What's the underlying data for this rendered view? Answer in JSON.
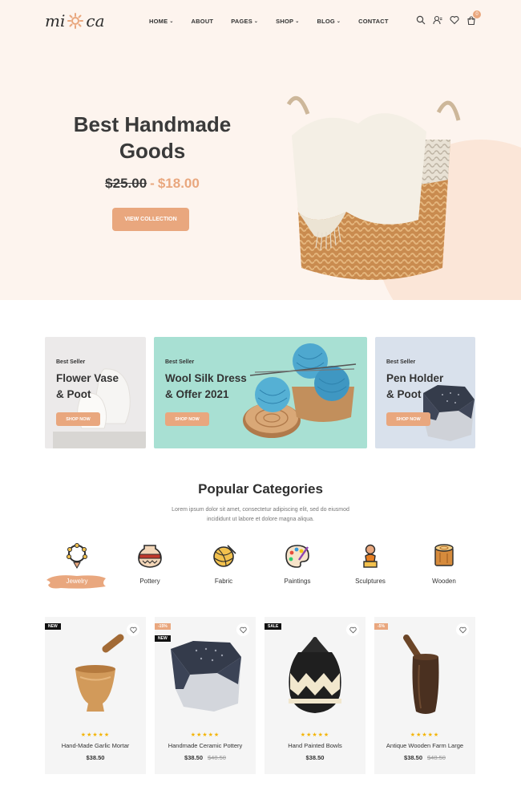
{
  "logo": {
    "left": "mi",
    "right": "ca"
  },
  "nav": [
    {
      "label": "HOME",
      "dropdown": true
    },
    {
      "label": "ABOUT",
      "dropdown": false
    },
    {
      "label": "PAGES",
      "dropdown": true
    },
    {
      "label": "SHOP",
      "dropdown": true
    },
    {
      "label": "BLOG",
      "dropdown": true
    },
    {
      "label": "CONTACT",
      "dropdown": false
    }
  ],
  "header_icons": [
    "search-icon",
    "user-icon",
    "heart-icon",
    "cart-icon"
  ],
  "cart_count": "0",
  "hero": {
    "title_line1": "Best Handmade",
    "title_line2": "Goods",
    "old_price": "$25.00",
    "separator": "-",
    "new_price": "$18.00",
    "button": "VIEW COLLECTION"
  },
  "promos": [
    {
      "tag": "Best Seller",
      "title_line1": "Flower Vase",
      "title_line2": "& Poot",
      "button": "SHOP NOW"
    },
    {
      "tag": "Best Seller",
      "title_line1": "Wool Silk Dress",
      "title_line2": "& Offer 2021",
      "button": "SHOP NOW"
    },
    {
      "tag": "Best Seller",
      "title_line1": "Pen Holder",
      "title_line2": "& Poot",
      "button": "SHOP NOW"
    }
  ],
  "categories_section": {
    "title": "Popular Categories",
    "desc_line1": "Lorem ipsum dolor sit amet, consectetur adipiscing elit, sed do eiusmod",
    "desc_line2": "incididunt ut labore et dolore magna aliqua."
  },
  "categories": [
    {
      "label": "Jewelry",
      "icon": "jewelry-icon",
      "active": true
    },
    {
      "label": "Pottery",
      "icon": "pottery-icon",
      "active": false
    },
    {
      "label": "Fabric",
      "icon": "yarn-icon",
      "active": false
    },
    {
      "label": "Paintings",
      "icon": "palette-icon",
      "active": false
    },
    {
      "label": "Sculptures",
      "icon": "sculpture-icon",
      "active": false
    },
    {
      "label": "Wooden",
      "icon": "wood-log-icon",
      "active": false
    }
  ],
  "products": [
    {
      "name": "Hand-Made Garlic Mortar",
      "price": "$38.50",
      "old_price": "",
      "labels": [
        "NEW"
      ],
      "rating": "★★★★★"
    },
    {
      "name": "Handmade Ceramic Pottery",
      "price": "$38.50",
      "old_price": "$48.50",
      "labels": [
        "-15%",
        "NEW"
      ],
      "rating": "★★★★★"
    },
    {
      "name": "Hand Painted Bowls",
      "price": "$38.50",
      "old_price": "",
      "labels": [
        "SALE"
      ],
      "rating": "★★★★★"
    },
    {
      "name": "Antique Wooden Farm Large",
      "price": "$38.50",
      "old_price": "$48.50",
      "labels": [
        "-5%"
      ],
      "rating": "★★★★★"
    }
  ],
  "colors": {
    "accent": "#e9a77e",
    "hero_bg": "#fdf4ee",
    "star": "#f4b400"
  }
}
